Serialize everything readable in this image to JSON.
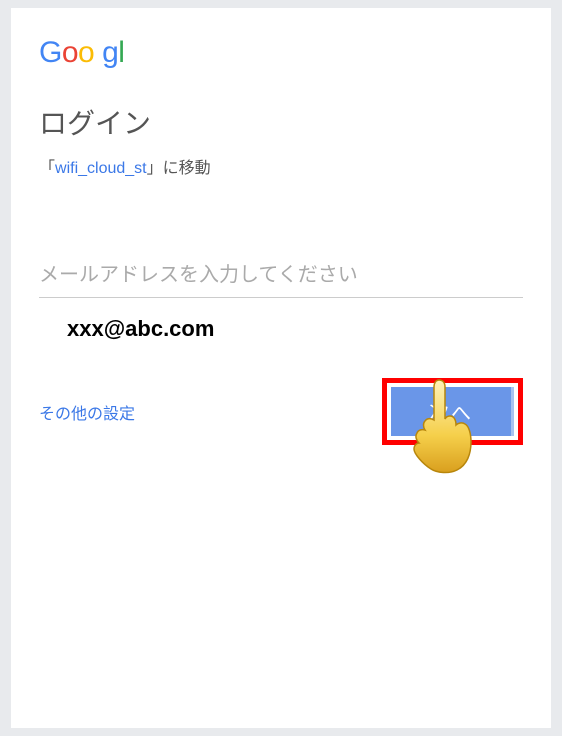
{
  "logo": {
    "g1": "G",
    "o1": "o",
    "o2": "o",
    "g2": "g",
    "l1": "l"
  },
  "title": "ログイン",
  "subtitle": {
    "prefix": "「",
    "link": "wifi_cloud_st",
    "suffix": "」に移動"
  },
  "input": {
    "placeholder": "メールアドレスを入力してください",
    "value": "xxx@abc.com"
  },
  "actions": {
    "other_settings": "その他の設定",
    "next": "次へ"
  }
}
